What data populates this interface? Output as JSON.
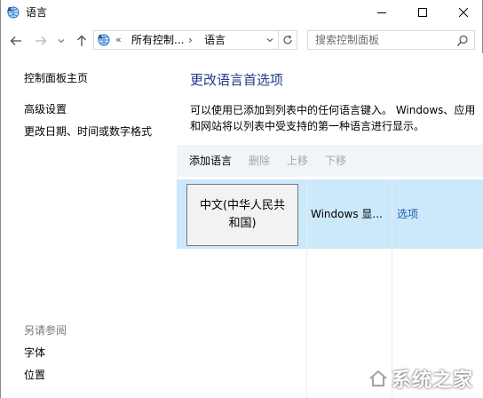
{
  "window": {
    "title": "语言",
    "icons": {
      "app": "globe-language-icon",
      "minimize": "minimize-icon",
      "maximize": "maximize-icon",
      "close": "close-icon"
    }
  },
  "nav": {
    "back": "back-arrow-icon",
    "forward": "forward-arrow-icon",
    "recent": "chevron-down-icon",
    "up": "up-arrow-icon"
  },
  "address": {
    "overflow": "«",
    "crumbs": [
      "所有控制...",
      "语言"
    ],
    "separator": "›",
    "refresh": "refresh-icon"
  },
  "search": {
    "placeholder": "搜索控制面板",
    "value": ""
  },
  "sidebar": {
    "home": "控制面板主页",
    "links": [
      "高级设置",
      "更改日期、时间或数字格式"
    ],
    "see_also_heading": "另请参阅",
    "see_also": [
      "字体",
      "位置"
    ]
  },
  "main": {
    "title": "更改语言首选项",
    "description": "可以使用已添加到列表中的任何语言键入。 Windows、应用和网站将以列表中受支持的第一种语言进行显示。",
    "toolbar": {
      "add": "添加语言",
      "remove": "删除",
      "up": "上移",
      "down": "下移"
    },
    "languages": [
      {
        "name": "中文(中华人民共和国)",
        "status": "Windows 显...",
        "options": "选项"
      }
    ]
  },
  "watermark": {
    "text": "系统之家"
  },
  "colors": {
    "title_blue": "#1f3c88",
    "link_blue": "#1c5ea8",
    "selected_row": "#cce8fb",
    "toolbar_bg": "#f1f5fa"
  }
}
